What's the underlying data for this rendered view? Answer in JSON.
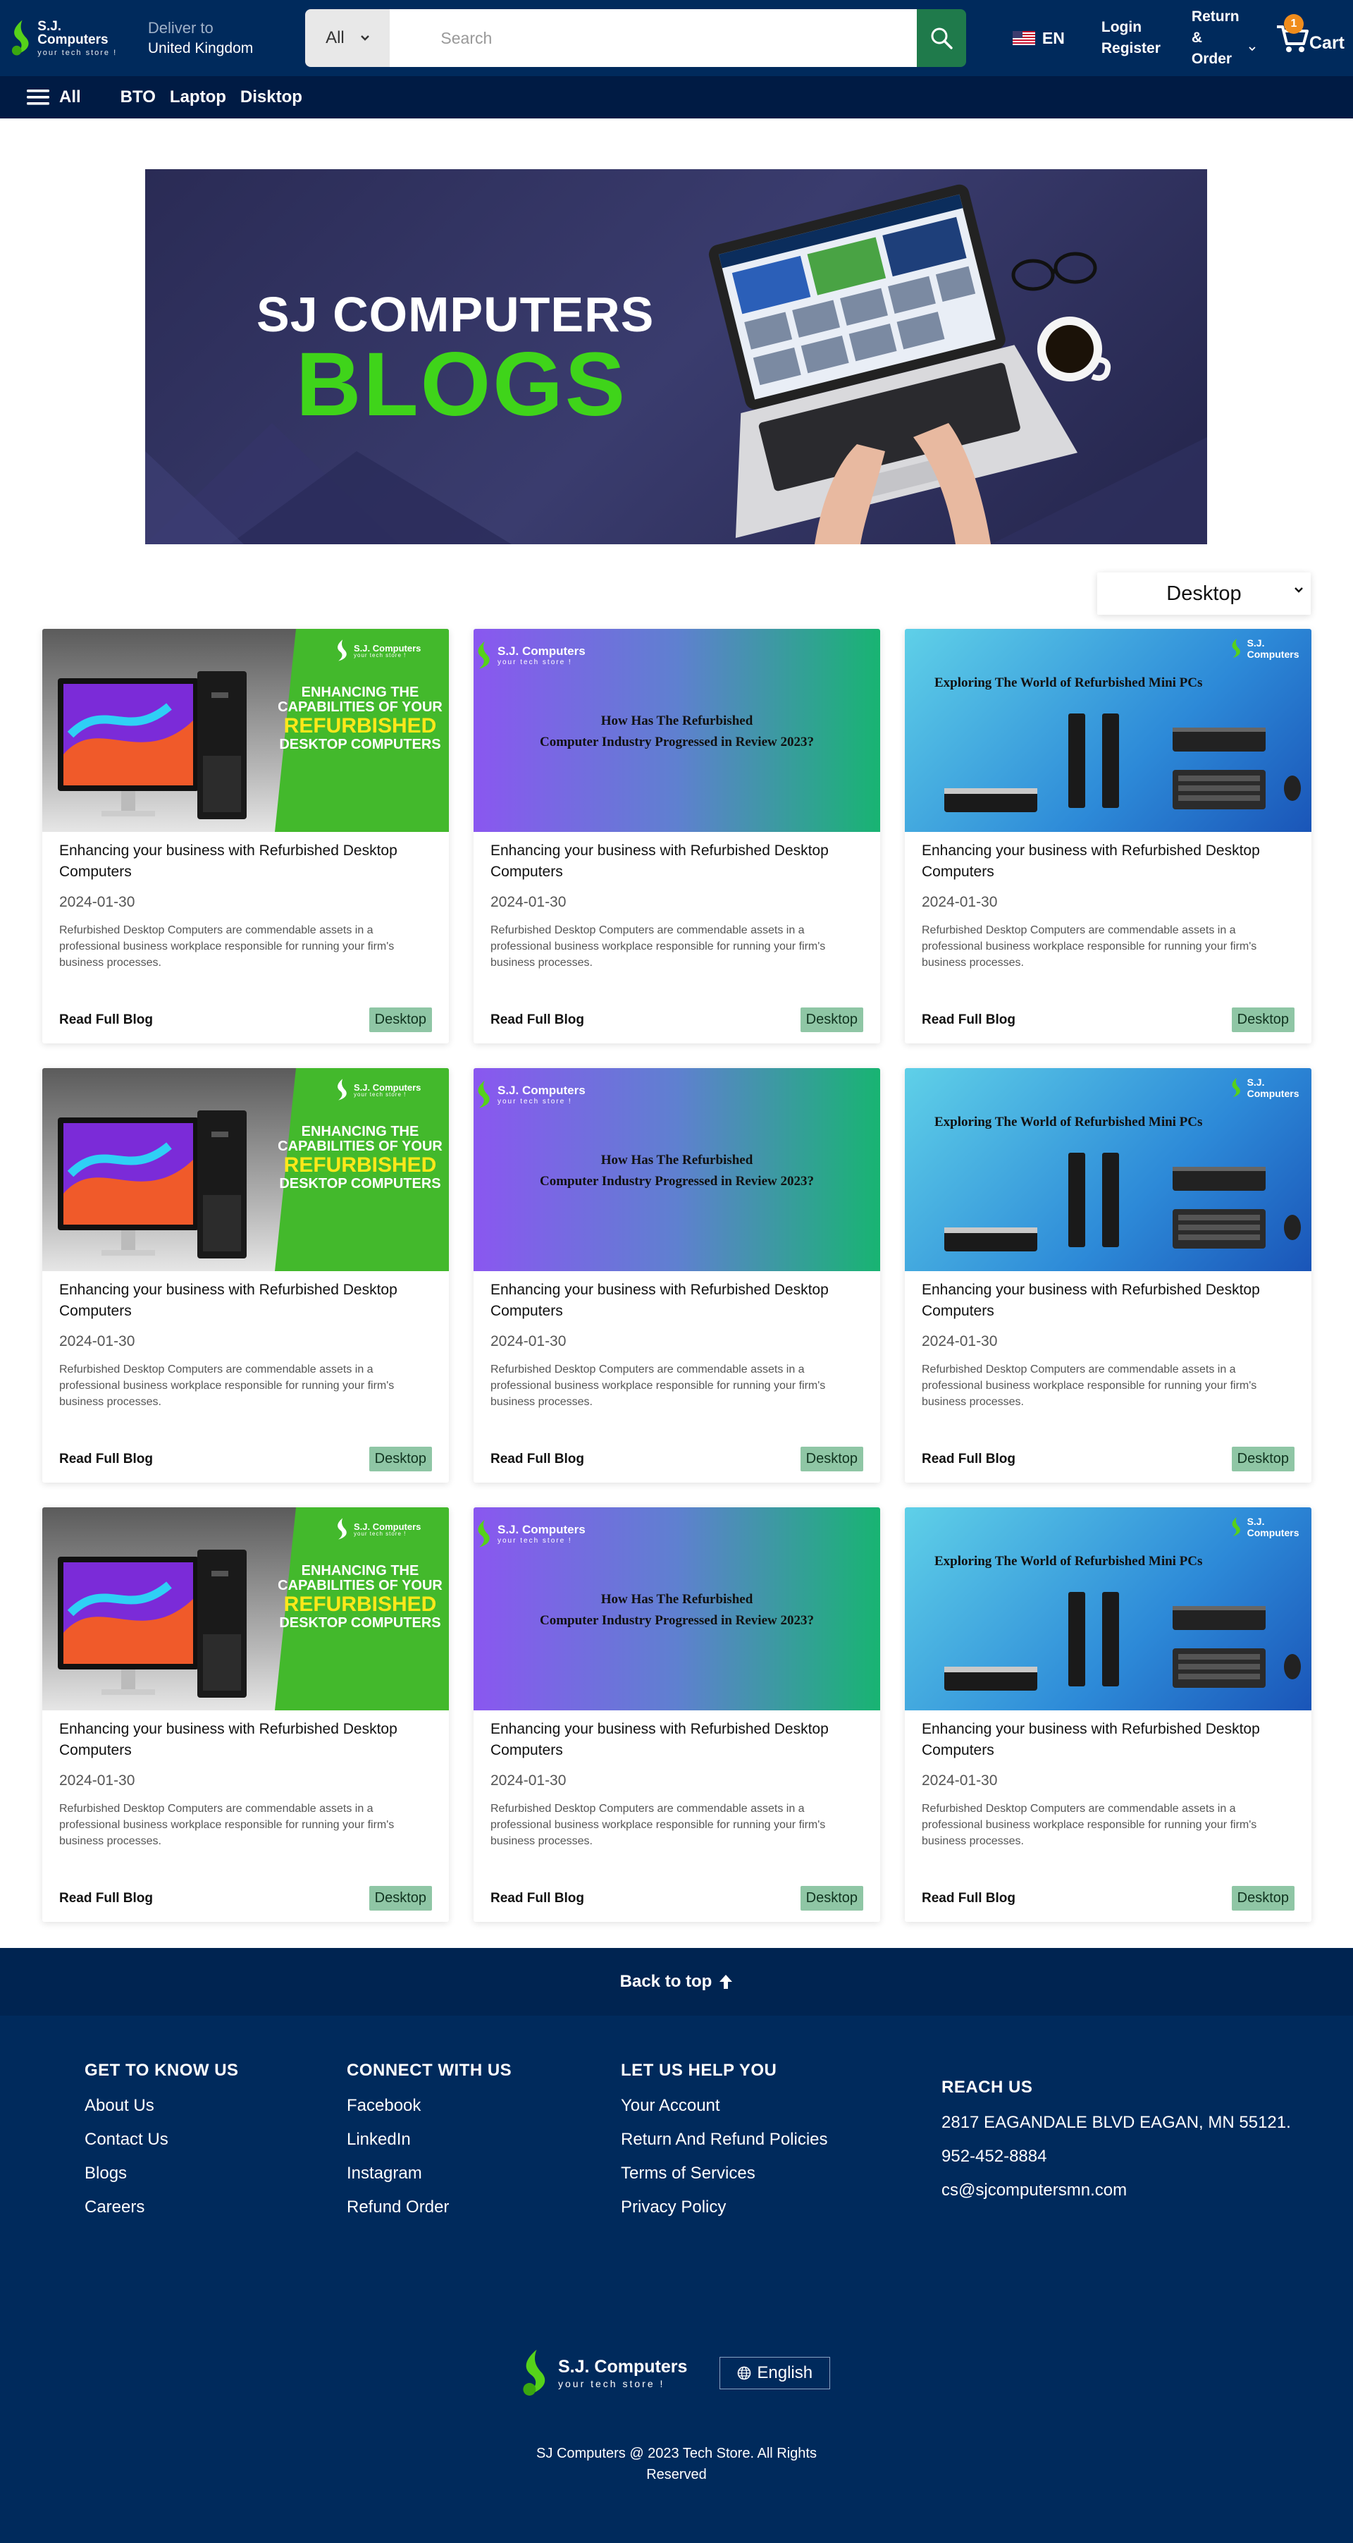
{
  "header": {
    "logo_title": "S.J. Computers",
    "logo_tagline": "your tech store !",
    "deliver_label": "Deliver to",
    "deliver_value": "United Kingdom",
    "search_category": "All",
    "search_placeholder": "Search",
    "language": "EN",
    "login_label": "Login",
    "register_label": "Register",
    "return_label": "Return",
    "order_label": "& Order",
    "cart_label": "Cart",
    "cart_count": "1"
  },
  "nav": {
    "all_label": "All",
    "links": [
      "BTO",
      "Laptop",
      "Disktop"
    ]
  },
  "hero": {
    "title": "SJ COMPUTERS",
    "subtitle": "BLOGS"
  },
  "filter": {
    "selected": "Desktop"
  },
  "art_text": {
    "green_brand": "S.J. Computers",
    "green_tag": "your tech store !",
    "green_line1": "ENHANCING THE",
    "green_line2": "CAPABILITIES OF YOUR",
    "green_line3": "REFURBISHED",
    "green_line4": "DESKTOP COMPUTERS",
    "purple_brand": "S.J. Computers",
    "purple_tag": "your tech store !",
    "purple_line1": "How Has The Refurbished",
    "purple_line2": "Computer Industry Progressed in Review 2023?",
    "blue_brand": "S.J. Computers",
    "blue_line1": "Exploring The World of Refurbished Mini PCs"
  },
  "cards": [
    {
      "variant": "green",
      "title": "Enhancing your business with Refurbished Desktop Computers",
      "date": "2024-01-30",
      "desc": "Refurbished Desktop Computers are commendable assets in a professional business workplace responsible for running your firm's business processes.",
      "read": "Read Full Blog",
      "tag": "Desktop"
    },
    {
      "variant": "purple",
      "title": "Enhancing your business with Refurbished Desktop Computers",
      "date": "2024-01-30",
      "desc": "Refurbished Desktop Computers are commendable assets in a professional business workplace responsible for running your firm's business processes.",
      "read": "Read Full Blog",
      "tag": "Desktop"
    },
    {
      "variant": "blue",
      "title": "Enhancing your business with Refurbished Desktop Computers",
      "date": "2024-01-30",
      "desc": "Refurbished Desktop Computers are commendable assets in a professional business workplace responsible for running your firm's business processes.",
      "read": "Read Full Blog",
      "tag": "Desktop"
    },
    {
      "variant": "green",
      "title": "Enhancing your business with Refurbished Desktop Computers",
      "date": "2024-01-30",
      "desc": "Refurbished Desktop Computers are commendable assets in a professional business workplace responsible for running your firm's business processes.",
      "read": "Read Full Blog",
      "tag": "Desktop"
    },
    {
      "variant": "purple",
      "title": "Enhancing your business with Refurbished Desktop Computers",
      "date": "2024-01-30",
      "desc": "Refurbished Desktop Computers are commendable assets in a professional business workplace responsible for running your firm's business processes.",
      "read": "Read Full Blog",
      "tag": "Desktop"
    },
    {
      "variant": "blue",
      "title": "Enhancing your business with Refurbished Desktop Computers",
      "date": "2024-01-30",
      "desc": "Refurbished Desktop Computers are commendable assets in a professional business workplace responsible for running your firm's business processes.",
      "read": "Read Full Blog",
      "tag": "Desktop"
    },
    {
      "variant": "green",
      "title": "Enhancing your business with Refurbished Desktop Computers",
      "date": "2024-01-30",
      "desc": "Refurbished Desktop Computers are commendable assets in a professional business workplace responsible for running your firm's business processes.",
      "read": "Read Full Blog",
      "tag": "Desktop"
    },
    {
      "variant": "purple",
      "title": "Enhancing your business with Refurbished Desktop Computers",
      "date": "2024-01-30",
      "desc": "Refurbished Desktop Computers are commendable assets in a professional business workplace responsible for running your firm's business processes.",
      "read": "Read Full Blog",
      "tag": "Desktop"
    },
    {
      "variant": "blue",
      "title": "Enhancing your business with Refurbished Desktop Computers",
      "date": "2024-01-30",
      "desc": "Refurbished Desktop Computers are commendable assets in a professional business workplace responsible for running your firm's business processes.",
      "read": "Read Full Blog",
      "tag": "Desktop"
    }
  ],
  "back_to_top": "Back to top",
  "footer": {
    "col1_title": "GET TO KNOW US",
    "col1_links": [
      "About Us",
      "Contact Us",
      "Blogs",
      "Careers"
    ],
    "col2_title": "CONNECT WITH US",
    "col2_links": [
      "Facebook",
      "LinkedIn",
      "Instagram",
      "Refund Order"
    ],
    "col3_title": "LET US HELP YOU",
    "col3_links": [
      "Your Account",
      "Return And Refund Policies",
      "Terms of Services",
      "Privacy Policy"
    ],
    "reach_title": "REACH US",
    "address": "2817 EAGANDALE BLVD EAGAN, MN 55121.",
    "phone": "952-452-8884",
    "email": "cs@sjcomputersmn.com",
    "logo_title": "S.J. Computers",
    "logo_tagline": "your tech store !",
    "language_button": "English",
    "copyright_line1": "SJ Computers @ 2023 Tech Store. All Rights",
    "copyright_line2": "Reserved"
  },
  "colors": {
    "header_bg": "#002a5c",
    "nav_bg": "#001b44",
    "brand_green": "#3fd41a",
    "search_button": "#1f7a4b",
    "tag_bg": "#8fc6a5",
    "cart_badge": "#f08c1c"
  },
  "icons": [
    "logo-icon",
    "chevron-down-icon",
    "search-icon",
    "us-flag-icon",
    "cart-icon",
    "menu-icon",
    "arrow-up-icon",
    "globe-icon"
  ]
}
